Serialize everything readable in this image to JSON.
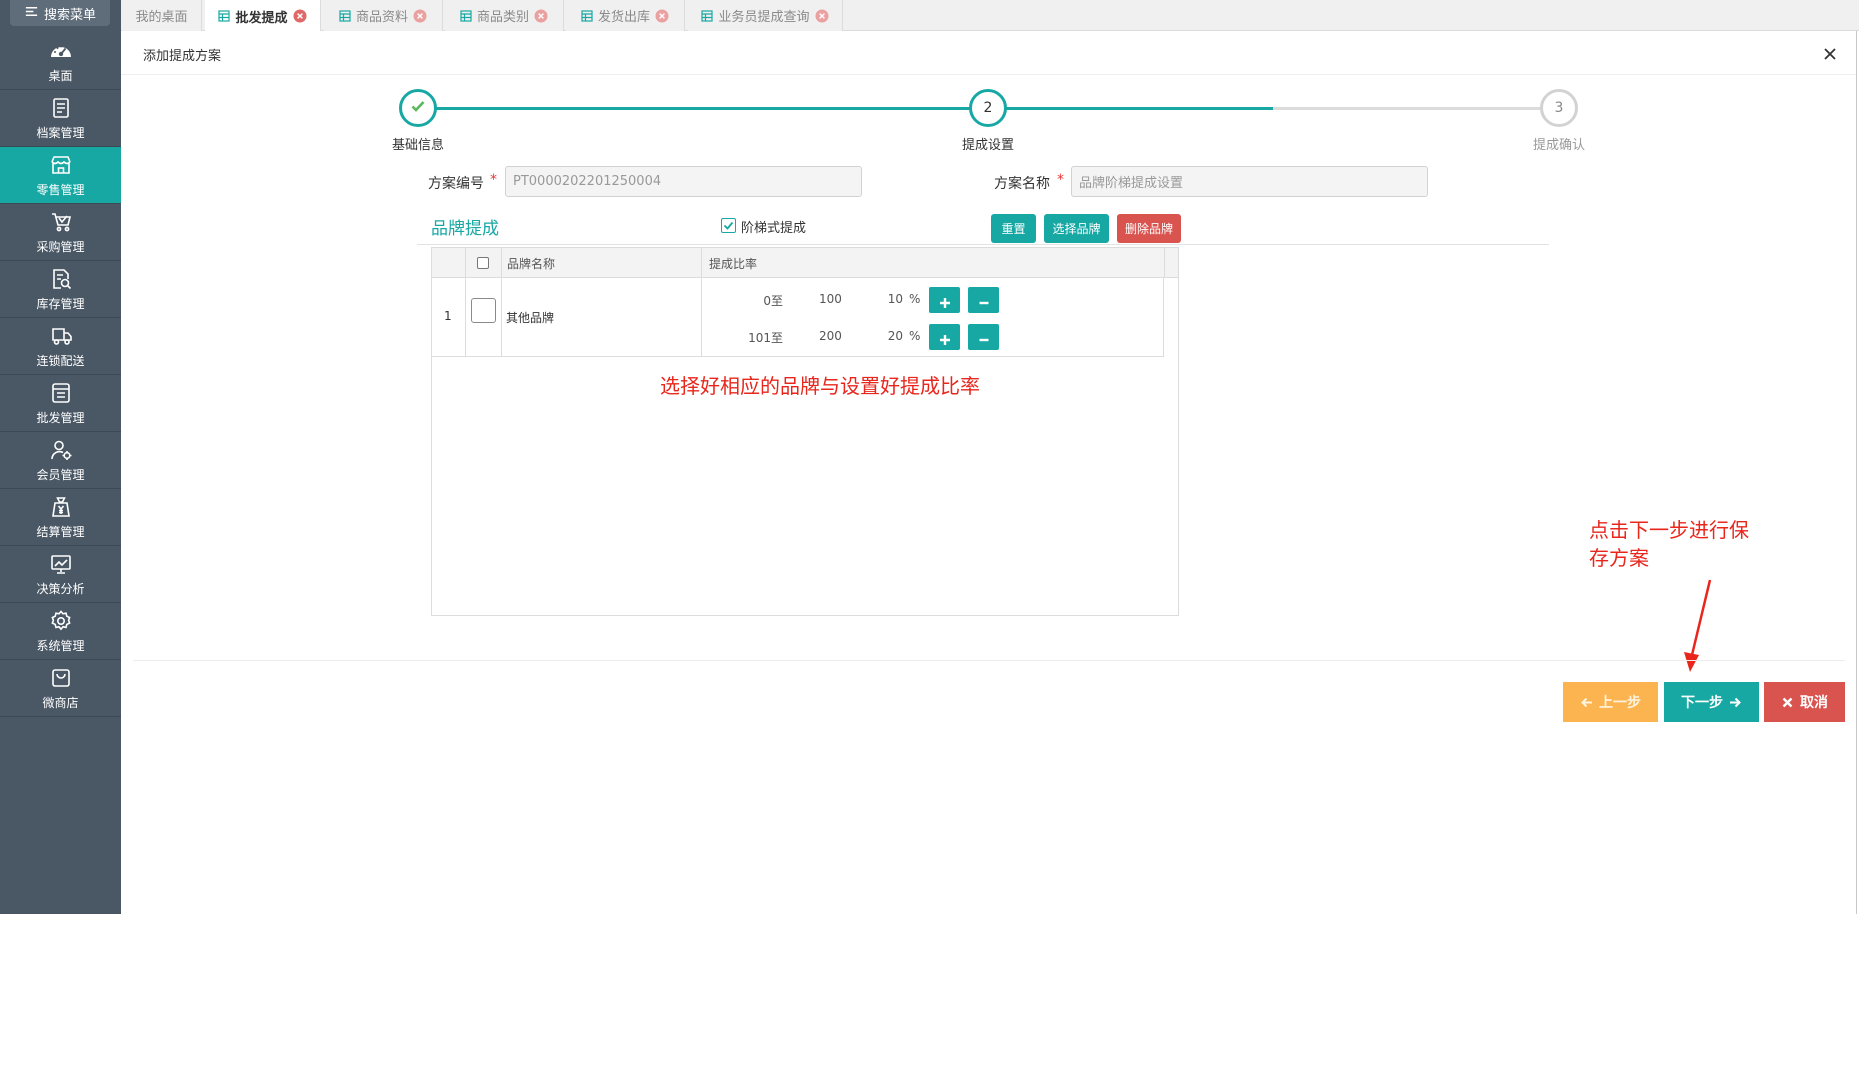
{
  "sidebar": {
    "search_label": "搜索菜单",
    "search_icon": "menu-icon",
    "items": [
      {
        "label": "桌面",
        "icon": "dashboard-icon"
      },
      {
        "label": "档案管理",
        "icon": "archive-icon"
      },
      {
        "label": "零售管理",
        "icon": "store-icon",
        "active": true
      },
      {
        "label": "采购管理",
        "icon": "cart-icon"
      },
      {
        "label": "库存管理",
        "icon": "inventory-icon"
      },
      {
        "label": "连锁配送",
        "icon": "delivery-truck-icon"
      },
      {
        "label": "批发管理",
        "icon": "wholesale-icon"
      },
      {
        "label": "会员管理",
        "icon": "member-icon"
      },
      {
        "label": "结算管理",
        "icon": "settlement-icon"
      },
      {
        "label": "决策分析",
        "icon": "analysis-chart-icon"
      },
      {
        "label": "系统管理",
        "icon": "gear-icon"
      },
      {
        "label": "微商店",
        "icon": "shopping-bag-icon"
      }
    ]
  },
  "tabs": [
    {
      "label": "我的桌面",
      "closable": false
    },
    {
      "label": "批发提成",
      "closable": true,
      "active": true
    },
    {
      "label": "商品资料",
      "closable": true
    },
    {
      "label": "商品类别",
      "closable": true
    },
    {
      "label": "发货出库",
      "closable": true
    },
    {
      "label": "业务员提成查询",
      "closable": true
    }
  ],
  "dialog": {
    "title": "添加提成方案",
    "close_icon": "close-icon"
  },
  "steps": [
    {
      "label": "基础信息",
      "state": "done",
      "icon": "check-icon"
    },
    {
      "number": "2",
      "label": "提成设置",
      "state": "active"
    },
    {
      "number": "3",
      "label": "提成确认",
      "state": "pending"
    }
  ],
  "steps_progress_fraction": 0.75,
  "form": {
    "scheme_no": {
      "label": "方案编号",
      "required_mark": "*",
      "value": "PT0000202201250004"
    },
    "scheme_name": {
      "label": "方案名称",
      "required_mark": "*",
      "value": "品牌阶梯提成设置"
    }
  },
  "section": {
    "title": "品牌提成",
    "tiered_checkbox": {
      "label": "阶梯式提成",
      "checked": true
    },
    "buttons": {
      "reset": "重置",
      "select_brand": "选择品牌",
      "delete_brand": "删除品牌"
    }
  },
  "table": {
    "headers": {
      "brand_name": "品牌名称",
      "rate": "提成比率"
    },
    "rows": [
      {
        "index": "1",
        "brand_name": "其他品牌",
        "tiers": [
          {
            "from": "0",
            "separator": "至",
            "to": "100",
            "rate": "10",
            "unit": "%",
            "add_icon": "plus-icon",
            "remove_icon": "minus-icon"
          },
          {
            "from": "101",
            "separator": "至",
            "to": "200",
            "rate": "20",
            "unit": "%",
            "add_icon": "plus-icon",
            "remove_icon": "minus-icon"
          }
        ]
      }
    ]
  },
  "annotations": {
    "table_hint": "选择好相应的品牌与设置好提成比率",
    "next_hint": "点击下一步进行保存方案"
  },
  "footer": {
    "prev": {
      "label": "上一步",
      "icon": "arrow-left-icon"
    },
    "next": {
      "label": "下一步",
      "icon": "arrow-right-icon"
    },
    "cancel": {
      "label": "取消",
      "icon": "times-icon"
    }
  },
  "colors": {
    "teal": "#17a8a4",
    "orange": "#fbb450",
    "red": "#d9534f",
    "sidebar": "#4a5765",
    "annotation": "#e8261c"
  }
}
